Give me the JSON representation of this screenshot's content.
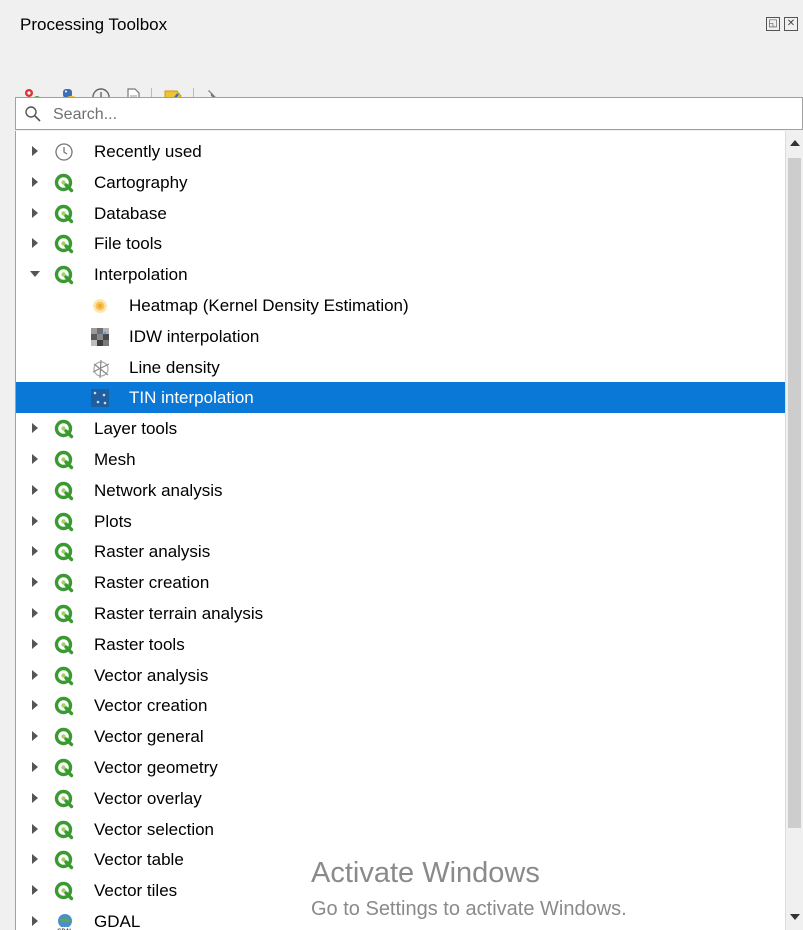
{
  "panel": {
    "title": "Processing Toolbox"
  },
  "toolbar": {
    "icons": [
      "models-icon",
      "python-icon",
      "history-icon",
      "results-icon",
      "edit-features-icon",
      "options-icon"
    ]
  },
  "search": {
    "placeholder": "Search..."
  },
  "tree": {
    "items": [
      {
        "label": "Recently used",
        "icon": "clock-icon",
        "state": "collapsed",
        "level": 0
      },
      {
        "label": "Cartography",
        "icon": "qgis-icon",
        "state": "collapsed",
        "level": 0
      },
      {
        "label": "Database",
        "icon": "qgis-icon",
        "state": "collapsed",
        "level": 0
      },
      {
        "label": "File tools",
        "icon": "qgis-icon",
        "state": "collapsed",
        "level": 0
      },
      {
        "label": "Interpolation",
        "icon": "qgis-icon",
        "state": "expanded",
        "level": 0
      },
      {
        "label": "Heatmap (Kernel Density Estimation)",
        "icon": "heatmap-icon",
        "state": "leaf",
        "level": 1
      },
      {
        "label": "IDW interpolation",
        "icon": "idw-icon",
        "state": "leaf",
        "level": 1
      },
      {
        "label": "Line density",
        "icon": "line-density-icon",
        "state": "leaf",
        "level": 1
      },
      {
        "label": "TIN interpolation",
        "icon": "tin-icon",
        "state": "leaf",
        "level": 1,
        "selected": true
      },
      {
        "label": "Layer tools",
        "icon": "qgis-icon",
        "state": "collapsed",
        "level": 0
      },
      {
        "label": "Mesh",
        "icon": "qgis-icon",
        "state": "collapsed",
        "level": 0
      },
      {
        "label": "Network analysis",
        "icon": "qgis-icon",
        "state": "collapsed",
        "level": 0
      },
      {
        "label": "Plots",
        "icon": "qgis-icon",
        "state": "collapsed",
        "level": 0
      },
      {
        "label": "Raster analysis",
        "icon": "qgis-icon",
        "state": "collapsed",
        "level": 0
      },
      {
        "label": "Raster creation",
        "icon": "qgis-icon",
        "state": "collapsed",
        "level": 0
      },
      {
        "label": "Raster terrain analysis",
        "icon": "qgis-icon",
        "state": "collapsed",
        "level": 0
      },
      {
        "label": "Raster tools",
        "icon": "qgis-icon",
        "state": "collapsed",
        "level": 0
      },
      {
        "label": "Vector analysis",
        "icon": "qgis-icon",
        "state": "collapsed",
        "level": 0
      },
      {
        "label": "Vector creation",
        "icon": "qgis-icon",
        "state": "collapsed",
        "level": 0
      },
      {
        "label": "Vector general",
        "icon": "qgis-icon",
        "state": "collapsed",
        "level": 0
      },
      {
        "label": "Vector geometry",
        "icon": "qgis-icon",
        "state": "collapsed",
        "level": 0
      },
      {
        "label": "Vector overlay",
        "icon": "qgis-icon",
        "state": "collapsed",
        "level": 0
      },
      {
        "label": "Vector selection",
        "icon": "qgis-icon",
        "state": "collapsed",
        "level": 0
      },
      {
        "label": "Vector table",
        "icon": "qgis-icon",
        "state": "collapsed",
        "level": 0
      },
      {
        "label": "Vector tiles",
        "icon": "qgis-icon",
        "state": "collapsed",
        "level": 0
      },
      {
        "label": "GDAL",
        "icon": "gdal-icon",
        "state": "collapsed",
        "level": 0
      }
    ]
  },
  "watermark": {
    "line1": "Activate Windows",
    "line2": "Go to Settings to activate Windows."
  },
  "colors": {
    "selection": "#0a78d7",
    "qgis_green": "#3a9a31",
    "qgis_light": "#9fd365"
  }
}
